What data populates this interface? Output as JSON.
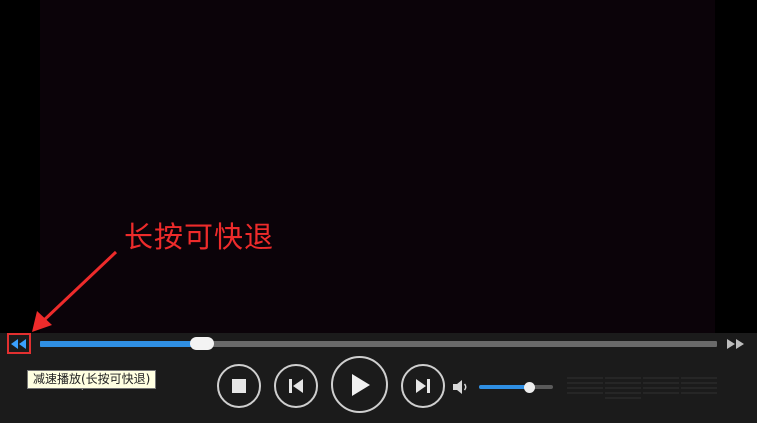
{
  "annotation": {
    "text": "长按可快退",
    "color": "#ee2b2b"
  },
  "controls": {
    "slow_down_icon": "rewind-double-triangle-icon",
    "fast_forward_icon": "fast-forward-double-triangle-icon",
    "tooltip": "减速播放(长按可快退)",
    "time_display": "00:32 / 03:20",
    "stop_icon": "stop-square-icon",
    "prev_icon": "skip-previous-icon",
    "play_icon": "play-triangle-icon",
    "next_icon": "skip-next-icon",
    "volume_icon": "speaker-icon"
  },
  "progress": {
    "played_fraction": 0.24
  },
  "volume": {
    "level_fraction": 0.68
  },
  "colors": {
    "accent": "#2f8fe3",
    "highlight_box": "#e23030",
    "video_bg": "#0b0309",
    "bar_bg": "#1b1b1b"
  }
}
